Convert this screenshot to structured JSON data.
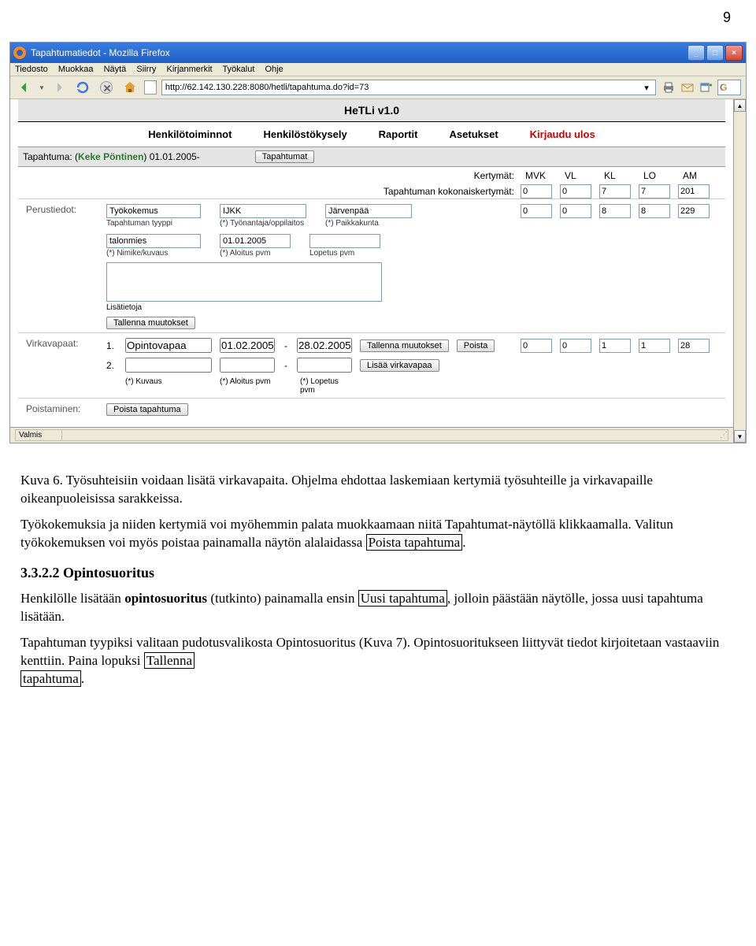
{
  "page_number": "9",
  "window": {
    "title": "Tapahtumatiedot - Mozilla Firefox",
    "menu": [
      "Tiedosto",
      "Muokkaa",
      "Näytä",
      "Siirry",
      "Kirjanmerkit",
      "Työkalut",
      "Ohje"
    ],
    "url": "http://62.142.130.228:8080/hetli/tapahtuma.do?id=73"
  },
  "app": {
    "header": "HeTLi v1.0",
    "nav": {
      "henkilotoiminnot": "Henkilötoiminnot",
      "henkilostokysely": "Henkilöstökysely",
      "raportit": "Raportit",
      "asetukset": "Asetukset",
      "kirjaudu_ulos": "Kirjaudu ulos"
    },
    "event_bar": {
      "label": "Tapahtuma: (",
      "person": "Keke Pöntinen",
      "date": ") 01.01.2005-",
      "btn": "Tapahtumat"
    },
    "kert": {
      "label1": "Kertymät:",
      "label2": "Tapahtuman kokonaiskertymät:",
      "cols": [
        "MVK",
        "VL",
        "KL",
        "LO",
        "AM"
      ],
      "row1": [
        "0",
        "0",
        "7",
        "7",
        "201"
      ],
      "row2": [
        "0",
        "0",
        "8",
        "8",
        "229"
      ]
    },
    "perustiedot": {
      "label": "Perustiedot:",
      "tyyppi": {
        "value": "Työkokemus",
        "caption": "Tapahtuman tyyppi"
      },
      "tyonantaja": {
        "value": "IJKK",
        "caption": "(*) Työnantaja/oppilaitos"
      },
      "paikkakunta": {
        "value": "Järvenpää",
        "caption": "(*) Paikkakunta"
      },
      "nimike": {
        "value": "talonmies",
        "caption": "(*) Nimike/kuvaus"
      },
      "aloitus": {
        "value": "01.01.2005",
        "caption": "(*) Aloitus pvm"
      },
      "lopetus": {
        "value": "",
        "caption": "Lopetus pvm"
      },
      "lisatietoja": "Lisätietoja",
      "tallenna": "Tallenna muutokset"
    },
    "virkavapaat": {
      "label": "Virkavapaat:",
      "row1": {
        "num": "1.",
        "kuvaus": "Opintovapaa",
        "aloitus": "01.02.2005",
        "lopetus": "28.02.2005",
        "tallenna": "Tallenna muutokset",
        "poista": "Poista"
      },
      "kert": [
        "0",
        "0",
        "1",
        "1",
        "28"
      ],
      "row2": {
        "num": "2.",
        "lisaa": "Lisää virkavapaa"
      },
      "caps": {
        "kuvaus": "(*) Kuvaus",
        "aloitus": "(*) Aloitus pvm",
        "lopetus": "(*) Lopetus pvm"
      }
    },
    "poistaminen": {
      "label": "Poistaminen:",
      "btn": "Poista tapahtuma"
    },
    "status": "Valmis"
  },
  "body": {
    "caption": "Kuva 6. Työsuhteisiin voidaan lisätä virkavapaita. Ohjelma ehdottaa laskemiaan kertymiä työsuhteille ja virkavapaille oikeanpuoleisissa sarakkeissa.",
    "p2a": "Työkokemuksia ja niiden kertymiä voi myöhemmin palata muokkaamaan niitä Tapahtumat-näytöllä klikkaamalla. Valitun työkokemuksen voi myös poistaa painamalla näytön alalaidassa ",
    "p2box": "Poista tapahtuma",
    "p2b": ".",
    "heading": "3.3.2.2 Opintosuoritus",
    "p3a": "Henkilölle lisätään ",
    "p3bold": "opintosuoritus",
    "p3b": " (tutkinto) painamalla ensin ",
    "p3box": "Uusi tapahtuma",
    "p3c": ", jolloin päästään näytölle, jossa uusi tapahtuma lisätään.",
    "p4a": "Tapahtuman tyypiksi valitaan pudotusvalikosta Opintosuoritus (Kuva 7). Opintosuoritukseen liittyvät tiedot kirjoitetaan vastaaviin kenttiin. Paina lopuksi ",
    "p4box1": "Tallenna",
    "p4box2": "tapahtuma",
    "p4b": "."
  }
}
